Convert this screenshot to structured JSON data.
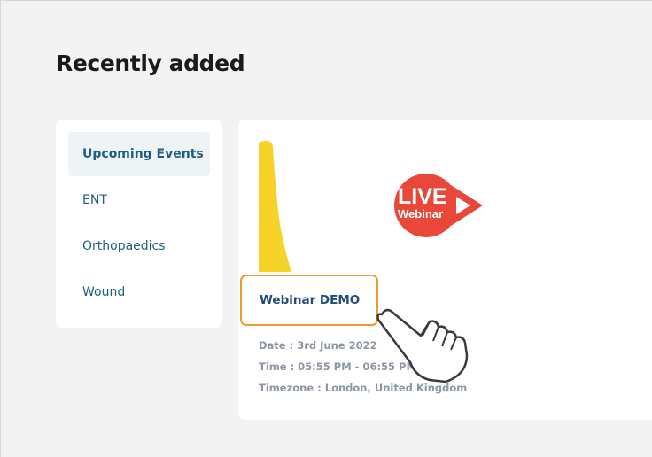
{
  "page": {
    "title": "Recently added"
  },
  "sidebar": {
    "items": [
      {
        "label": "Upcoming Events",
        "active": true
      },
      {
        "label": "ENT",
        "active": false
      },
      {
        "label": "Orthopaedics",
        "active": false
      },
      {
        "label": "Wound",
        "active": false
      }
    ]
  },
  "event": {
    "badge": {
      "line1": "LIVE",
      "line2": "Webinar",
      "color": "#e8473a"
    },
    "thumbnail_color": "#f6d328",
    "title": "Webinar DEMO",
    "date": "Date : 3rd June 2022",
    "time": "Time : 05:55 PM - 06:55 PM",
    "timezone": "Timezone : London, United Kingdom"
  },
  "colors": {
    "accent": "#1f5e82",
    "highlight_outline": "#f0992e",
    "background": "#f3f3f4"
  },
  "icons": {
    "pointer": "hand-pointer-icon",
    "play": "play-icon"
  }
}
